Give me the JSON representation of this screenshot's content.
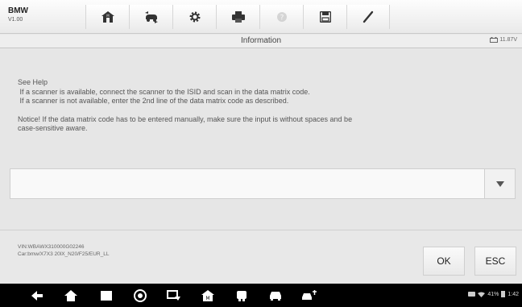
{
  "app": {
    "name": "BMW",
    "version": "V1.00"
  },
  "toolbar": {
    "items": [
      {
        "icon": "home-icon"
      },
      {
        "icon": "vehicle-swap-icon"
      },
      {
        "icon": "settings-gear-icon"
      },
      {
        "icon": "print-icon"
      },
      {
        "icon": "help-icon",
        "disabled": true
      },
      {
        "icon": "save-icon"
      },
      {
        "icon": "pen-icon"
      }
    ]
  },
  "header": {
    "title": "Information",
    "battery": "11.87V"
  },
  "message": {
    "lines": [
      "See Help",
      " If a scanner is available, connect the scanner to the ISID and scan in the data matrix code.",
      " If a scanner is not available, enter the 2nd line of the data matrix code as described.",
      "",
      "Notice! If the data matrix code has to be entered manually, make sure the input is without spaces and be",
      "case-sensitive aware."
    ]
  },
  "input": {
    "value": ""
  },
  "vehicle": {
    "vin": "VIN:WBAWX310000G02246",
    "car": "Car:bmw/X7X3 20lX_N20/F25/EUR_LL"
  },
  "buttons": {
    "ok": "OK",
    "esc": "ESC"
  },
  "statusbar": {
    "battery_pct": "41%",
    "time": "1:42"
  },
  "colors": {
    "toolbar_bg": "#f2f2f2",
    "content_bg": "#e6e6e6",
    "navbar_bg": "#000000"
  }
}
